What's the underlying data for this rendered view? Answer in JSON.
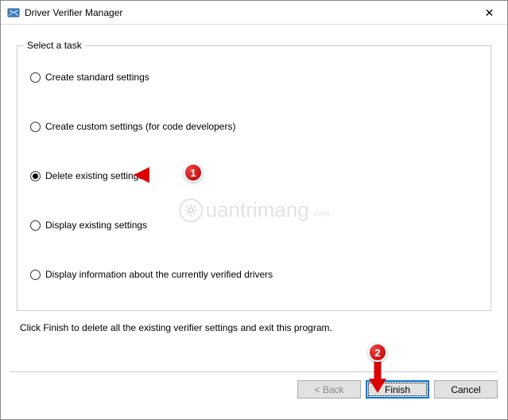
{
  "window": {
    "title": "Driver Verifier Manager",
    "close_glyph": "✕"
  },
  "group": {
    "legend": "Select a task",
    "options": [
      {
        "label": "Create standard settings",
        "checked": false
      },
      {
        "label": "Create custom settings (for code developers)",
        "checked": false
      },
      {
        "label": "Delete existing settings",
        "checked": true
      },
      {
        "label": "Display existing settings",
        "checked": false
      },
      {
        "label": "Display information about the currently verified drivers",
        "checked": false
      }
    ]
  },
  "hint": "Click Finish to delete all the existing verifier settings and exit this program.",
  "buttons": {
    "back": "< Back",
    "finish": "Finish",
    "cancel": "Cancel"
  },
  "annotations": {
    "callout1": "1",
    "callout2": "2"
  },
  "watermark": {
    "text": "uantrimang"
  }
}
